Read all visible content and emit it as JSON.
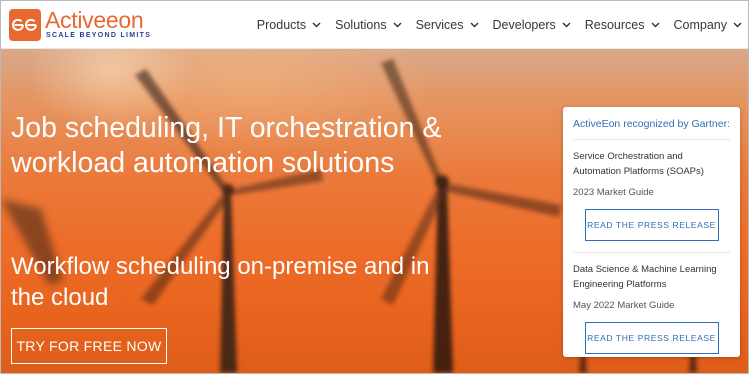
{
  "brand": {
    "name": "Activeeon",
    "tagline": "SCALE BEYOND LIMITS",
    "accent_color": "#e8692f",
    "tagline_color": "#2c3d8f"
  },
  "nav": {
    "items": [
      {
        "label": "Products",
        "icon": "chevron-down-icon"
      },
      {
        "label": "Solutions",
        "icon": "chevron-down-icon"
      },
      {
        "label": "Services",
        "icon": "chevron-down-icon"
      },
      {
        "label": "Developers",
        "icon": "chevron-down-icon"
      },
      {
        "label": "Resources",
        "icon": "chevron-down-icon"
      },
      {
        "label": "Company",
        "icon": "chevron-down-icon"
      }
    ]
  },
  "hero": {
    "heading": "Job scheduling, IT orchestration & workload automation solutions",
    "subheading": "Workflow scheduling on-premise and in the cloud",
    "cta_label": "TRY FOR FREE NOW",
    "background": "orange sunset sky with wind turbines"
  },
  "gartner": {
    "title": "ActiveEon recognized by Gartner:",
    "link_color": "#2f6fb6",
    "items": [
      {
        "name": "Service Orchestration and Automation Platforms (SOAPs)",
        "guide": "2023 Market Guide",
        "button_label": "READ THE PRESS RELEASE"
      },
      {
        "name": "Data Science & Machine Learning Engineering Platforms",
        "guide": "May 2022 Market Guide",
        "button_label": "READ THE PRESS RELEASE"
      }
    ]
  }
}
